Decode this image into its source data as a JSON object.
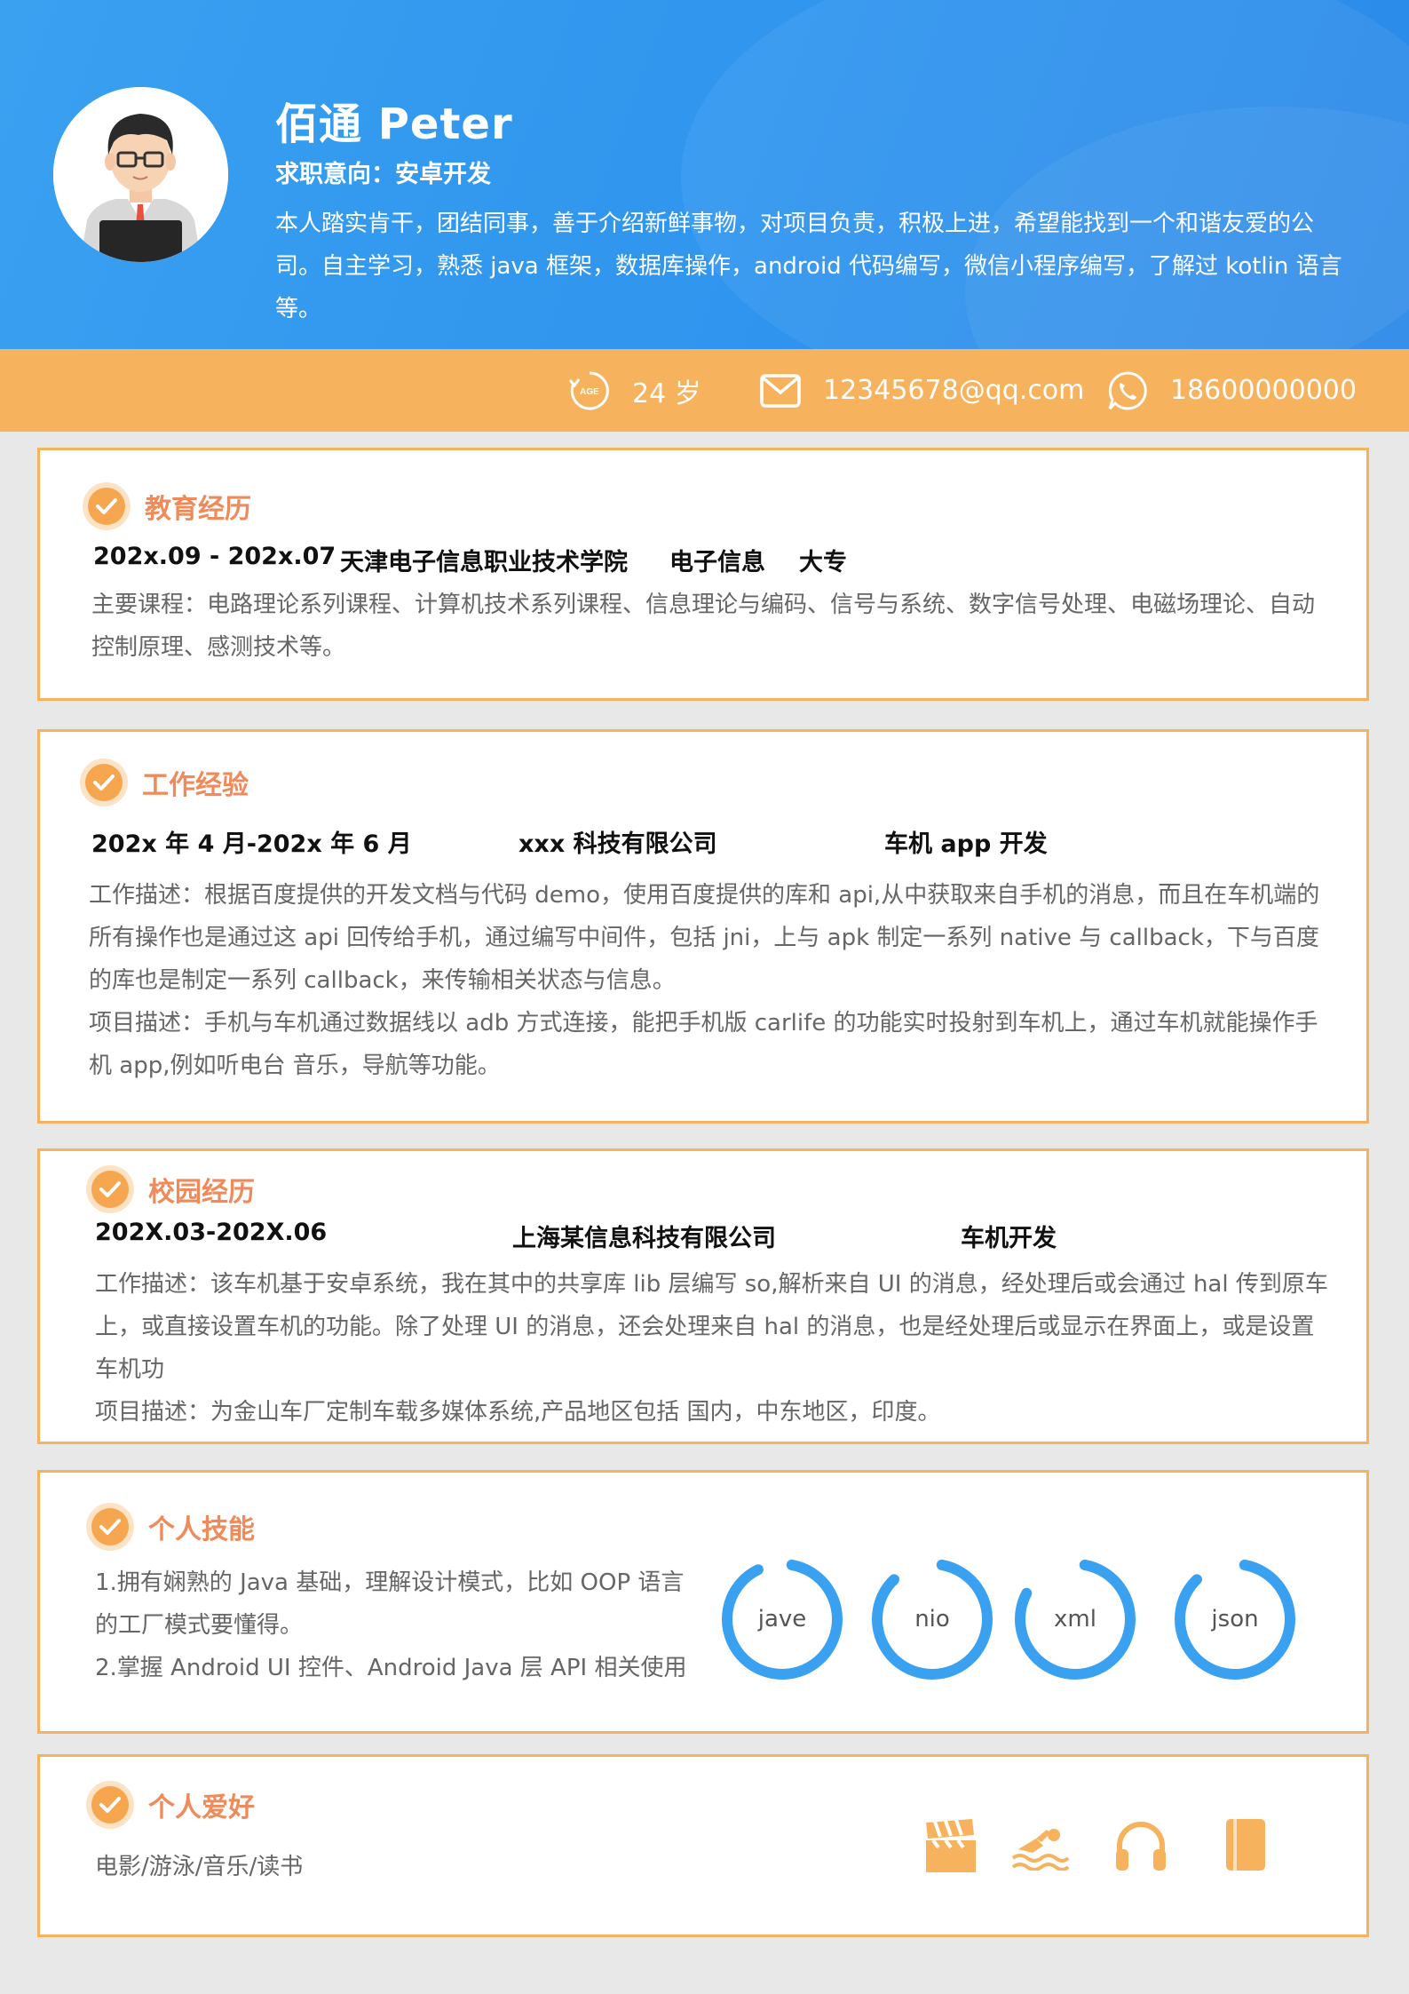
{
  "header": {
    "name": "佰通  Peter",
    "intent": "求职意向：安卓开发",
    "intro": "本人踏实肯干，团结同事，善于介绍新鲜事物，对项目负责，积极上进，希望能找到一个和谐友爱的公司。自主学习，熟悉 java 框架，数据库操作，android 代码编写，微信小程序编写，了解过 kotlin 语言等。"
  },
  "contact": {
    "age_icon_text": "AGE",
    "age": "24 岁",
    "email": "12345678@qq.com",
    "phone": "18600000000"
  },
  "education": {
    "title": "教育经历",
    "period": "202x.09 - 202x.07",
    "school": "天津电子信息职业技术学院",
    "major": "电子信息",
    "degree": "大专",
    "desc": "主要课程：电路理论系列课程、计算机技术系列课程、信息理论与编码、信号与系统、数字信号处理、电磁场理论、自动控制原理、感测技术等。"
  },
  "work": {
    "title": "工作经验",
    "period": "202x 年 4 月-202x 年 6 月",
    "company": "xxx 科技有限公司",
    "role": "车机 app 开发",
    "desc1": "工作描述：根据百度提供的开发文档与代码 demo，使用百度提供的库和 api,从中获取来自手机的消息，而且在车机端的所有操作也是通过这 api 回传给手机，通过编写中间件，包括 jni，上与 apk 制定一系列 native 与 callback，下与百度的库也是制定一系列 callback，来传输相关状态与信息。",
    "desc2": "项目描述：手机与车机通过数据线以 adb 方式连接，能把手机版 carlife 的功能实时投射到车机上，通过车机就能操作手机 app,例如听电台  音乐，导航等功能。"
  },
  "campus": {
    "title": "校园经历",
    "period": "202X.03-202X.06",
    "company": "上海某信息科技有限公司",
    "role": "车机开发",
    "desc1": "工作描述：该车机基于安卓系统，我在其中的共享库 lib 层编写 so,解析来自 UI 的消息，经处理后或会通过 hal 传到原车上，或直接设置车机的功能。除了处理 UI 的消息，还会处理来自 hal 的消息，也是经处理后或显示在界面上，或是设置车机功",
    "desc2": "项目描述：为金山车厂定制车载多媒体系统,产品地区包括  国内，中东地区，印度。"
  },
  "skills": {
    "title": "个人技能",
    "desc1": "1.拥有娴熟的 Java 基础，理解设计模式，比如 OOP 语言的工厂模式要懂得。",
    "desc2": "2.掌握 Android UI 控件、Android Java 层 API 相关使用",
    "rings": [
      {
        "label": "jave",
        "level": 0.9
      },
      {
        "label": "nio",
        "level": 0.85
      },
      {
        "label": "xml",
        "level": 0.8
      },
      {
        "label": "json",
        "level": 0.85
      }
    ]
  },
  "hobbies": {
    "title": "个人爱好",
    "desc": "电影/游泳/音乐/读书",
    "icons": [
      "film-clapper-icon",
      "swimming-icon",
      "headphones-icon",
      "book-icon"
    ]
  },
  "colors": {
    "accent": "#f6b25c",
    "title": "#ef8a5b",
    "blue": "#3aa0f0"
  }
}
